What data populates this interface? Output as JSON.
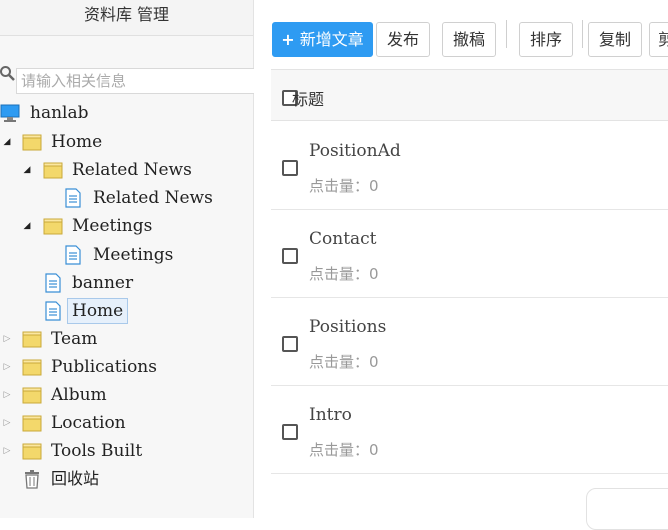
{
  "sidebar": {
    "title": "资料库 管理",
    "search_placeholder": "请输入相关信息",
    "tree": {
      "root": "hanlab",
      "home": "Home",
      "related_news_folder": "Related News",
      "related_news_doc": "Related News",
      "meetings_folder": "Meetings",
      "meetings_doc": "Meetings",
      "banner": "banner",
      "home_doc": "Home",
      "team": "Team",
      "publications": "Publications",
      "album": "Album",
      "location": "Location",
      "tools_built": "Tools Built",
      "recycle_bin": "回收站"
    }
  },
  "toolbar": {
    "add": "新增文章",
    "publish": "发布",
    "withdraw": "撤稿",
    "sort": "排序",
    "copy": "复制",
    "cut": "剪"
  },
  "grid": {
    "header_title": "标题",
    "rows": [
      {
        "title": "PositionAd",
        "clicks": "点击量：0"
      },
      {
        "title": "Contact",
        "clicks": "点击量：0"
      },
      {
        "title": "Positions",
        "clicks": "点击量：0"
      },
      {
        "title": "Intro",
        "clicks": "点击量：0"
      }
    ]
  },
  "colors": {
    "primary": "#2e9bf2",
    "folder": "#f3d86b",
    "doc": "#3a8fd6",
    "monitor": "#2e9bf2"
  }
}
